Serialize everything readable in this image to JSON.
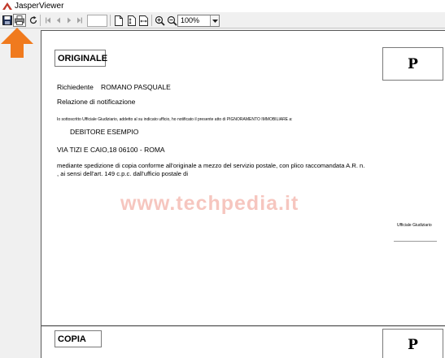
{
  "window": {
    "title": "JasperViewer"
  },
  "toolbar": {
    "zoom_value": "100%",
    "page_number": "",
    "buttons": [
      {
        "name": "save-button",
        "icon": "floppy-disk-icon"
      },
      {
        "name": "print-button",
        "icon": "printer-icon"
      },
      {
        "name": "reload-button",
        "icon": "reload-icon"
      },
      {
        "name": "first-page-button",
        "icon": "first-page-icon"
      },
      {
        "name": "previous-page-button",
        "icon": "previous-page-icon"
      },
      {
        "name": "next-page-button",
        "icon": "next-page-icon"
      },
      {
        "name": "last-page-button",
        "icon": "last-page-icon"
      },
      {
        "name": "actual-size-button",
        "icon": "actual-size-icon"
      },
      {
        "name": "fit-page-button",
        "icon": "fit-page-icon"
      },
      {
        "name": "fit-width-button",
        "icon": "fit-width-icon"
      },
      {
        "name": "zoom-in-button",
        "icon": "zoom-in-icon"
      },
      {
        "name": "zoom-out-button",
        "icon": "zoom-out-icon"
      }
    ]
  },
  "document": {
    "original_label": "ORIGINALE",
    "p_mark": "P",
    "requester_label": "Richiedente",
    "requester_name": "ROMANO PASQUALE",
    "report_title": "Relazione di notificazione",
    "declaration": "Io sottoscritto Ufficiale Giudiziario, addetto al su indicato ufficio, ho notificato il presente atto di PIGNORAMENTO IMMOBILIARE a:",
    "debtor": "DEBITORE ESEMPIO",
    "address": "VIA TIZI E CAIO,18 06100 - ROMA",
    "delivery_line1": "mediante spedizione di copia conforme all'originale a mezzo del servizio postale, con plico raccomandata A.R. n.",
    "delivery_line2": ", ai sensi dell'art. 149 c.p.c. dall'ufficio postale di",
    "officer_label": "Ufficiale Giudiziario",
    "copy_label": "COPIA",
    "copy_p_mark": "P"
  },
  "watermark": {
    "text": "www.techpedia.it"
  },
  "colors": {
    "arrow": "#f07a1e",
    "watermark": "#e4462d",
    "titlebar_icon": "#c0392b"
  }
}
